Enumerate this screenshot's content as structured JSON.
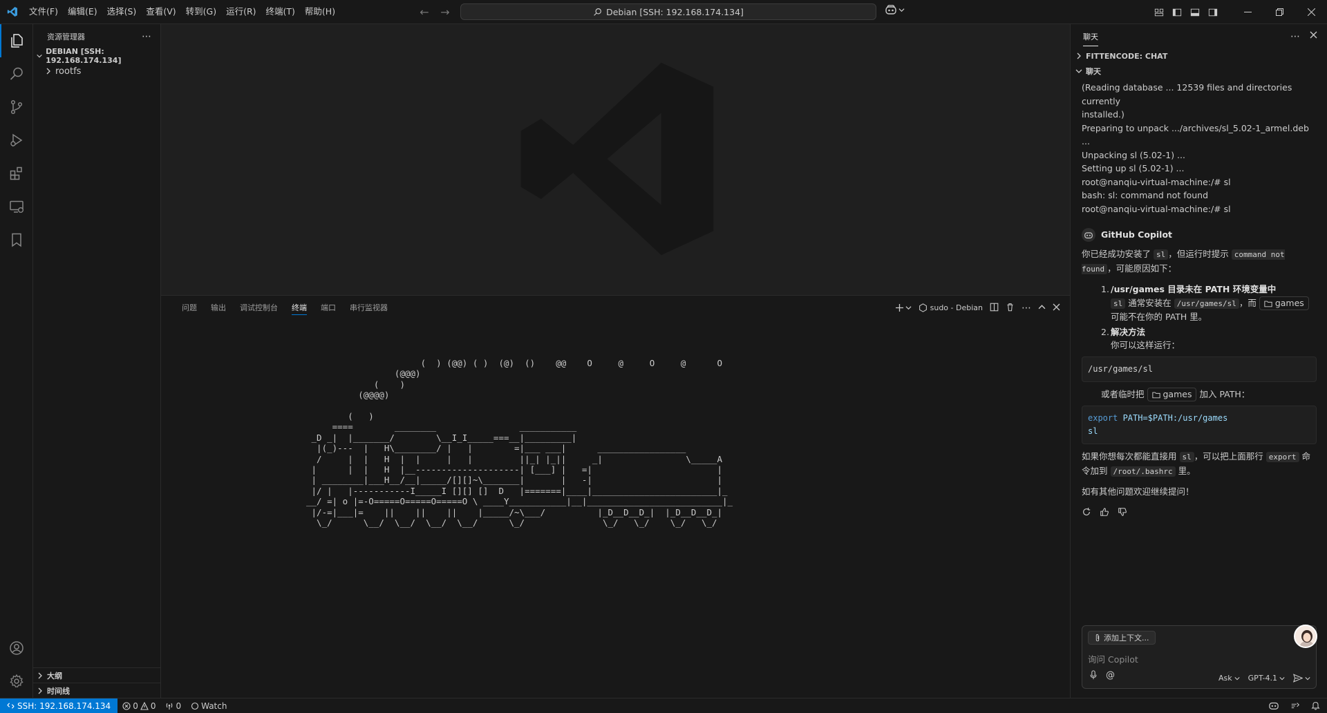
{
  "titlebar": {
    "menu": [
      "文件(F)",
      "编辑(E)",
      "选择(S)",
      "查看(V)",
      "转到(G)",
      "运行(R)",
      "终端(T)",
      "帮助(H)"
    ],
    "search": "Debian [SSH: 192.168.174.134]"
  },
  "sidebar": {
    "title": "资源管理器",
    "root": "DEBIAN [SSH: 192.168.174.134]",
    "items": [
      "rootfs"
    ],
    "outline": "大纲",
    "timeline": "时间线"
  },
  "panel": {
    "tabs": [
      "问题",
      "输出",
      "调试控制台",
      "终端",
      "端口",
      "串行监视器"
    ],
    "terminal_name": "sudo - Debian",
    "terminal_ascii": "                      (  ) (@@) ( )  (@)  ()    @@    O     @     O     @      O\n                 (@@@)\n             (    )\n          (@@@@)\n\n        (   )\n     ====        ________                ___________\n _D _|  |_______/        \\__I_I_____===__|_________|\n  |(_)---  |   H\\________/ |   |        =|___ ___|      _________________\n  /     |  |   H  |  |     |   |         ||_| |_||     _|                \\_____A\n |      |  |   H  |__--------------------| [___] |   =|                        |\n | ________|___H__/__|_____/[][]~\\_______|       |   -|                        |\n |/ |   |-----------I_____I [][] []  D   |=======|____|________________________|_\n__/ =| o |=-O=====O=====O=====O \\ ____Y___________|__|__________________________|_\n |/-=|___|=    ||    ||    ||    |_____/~\\___/          |_D__D__D_|  |_D__D__D_|\n  \\_/      \\__/  \\__/  \\__/  \\__/      \\_/               \\_/   \\_/    \\_/   \\_/"
  },
  "chat": {
    "tab": "聊天",
    "section1": "FITTENCODE: CHAT",
    "section2": "聊天",
    "terminal_lines": [
      "(Reading database ... 12539 files and directories currently",
      "installed.)",
      "Preparing to unpack .../archives/sl_5.02-1_armel.deb ...",
      "Unpacking sl (5.02-1) ...",
      "Setting up sl (5.02-1) ...",
      "root@nanqiu-virtual-machine:/# sl",
      "bash: sl: command not found",
      "root@nanqiu-virtual-machine:/# sl"
    ],
    "assistant": "GitHub Copilot",
    "p1_a": "你已经成功安装了",
    "p1_code1": "sl",
    "p1_b": "，但运行时提示",
    "p1_code2": "command not found",
    "p1_c": "，可能原因如下：",
    "li1_num": "1.",
    "li1_title": "/usr/games 目录未在 PATH 环境变量中",
    "li1_code1": "sl",
    "li1_a": "通常安装在",
    "li1_code2": "/usr/games/sl",
    "li1_b": "，而",
    "li1_chip": "games",
    "li1_c": "可能不在你的 PATH 里。",
    "li2_num": "2.",
    "li2_title": "解决方法",
    "li2_text": "你可以这样运行：",
    "code1": "/usr/games/sl",
    "p2_a": "或者临时把",
    "p2_chip": "games",
    "p2_b": "加入 PATH：",
    "code2_kw": "export",
    "code2_rest": " PATH=$PATH:/usr/games",
    "code2_line2": "sl",
    "p3_a": "如果你想每次都能直接用",
    "p3_code1": "sl",
    "p3_b": "，可以把上面那行",
    "p3_code2": "export",
    "p3_c": "命令加到",
    "p3_code3": "/root/.bashrc",
    "p3_d": "里。",
    "p4": "如有其他问题欢迎继续提问！",
    "input": {
      "add_context": "添加上下文...",
      "placeholder": "询问 Copilot",
      "mode": "Ask",
      "model": "GPT-4.1"
    }
  },
  "statusbar": {
    "remote": "SSH: 192.168.174.134",
    "errors": "0",
    "warnings": "0",
    "ports": "0",
    "watch": "Watch"
  },
  "colors": {
    "accent": "#0078d4",
    "background": "#1f1f1f",
    "chrome": "#181818"
  }
}
